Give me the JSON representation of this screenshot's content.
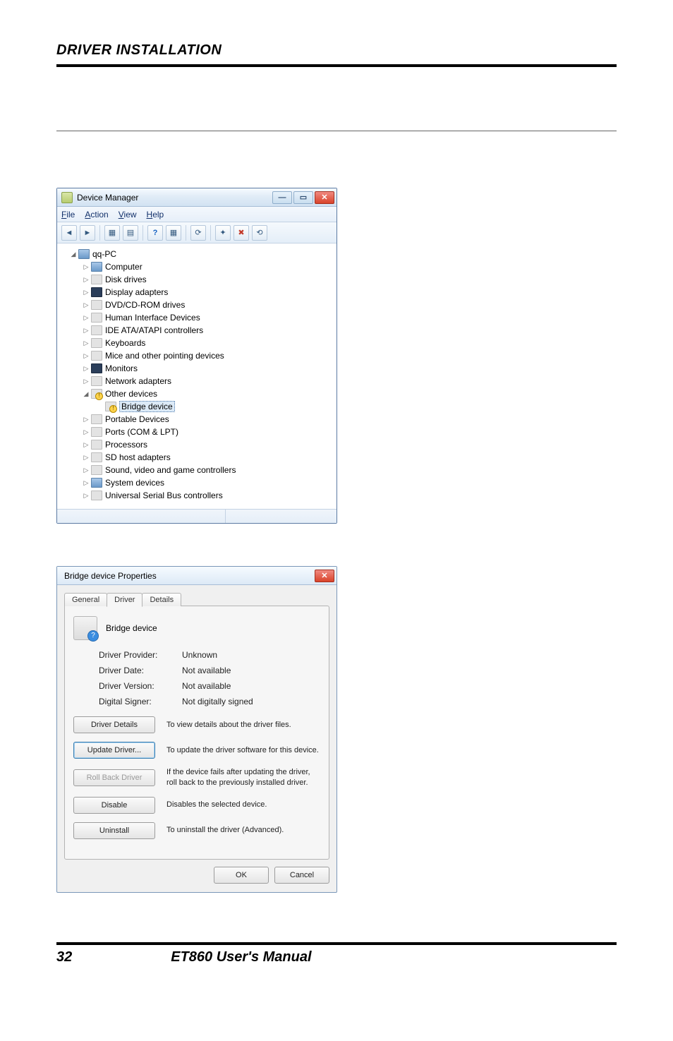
{
  "page": {
    "header": "DRIVER INSTALLATION",
    "page_number": "32",
    "footer_title": "ET860 User's Manual"
  },
  "device_manager": {
    "window_title": "Device Manager",
    "menus": {
      "file": "File",
      "action": "Action",
      "view": "View",
      "help": "Help"
    },
    "root": "qq-PC",
    "nodes": [
      "Computer",
      "Disk drives",
      "Display adapters",
      "DVD/CD-ROM drives",
      "Human Interface Devices",
      "IDE ATA/ATAPI controllers",
      "Keyboards",
      "Mice and other pointing devices",
      "Monitors",
      "Network adapters",
      "Other devices",
      "Portable Devices",
      "Ports (COM & LPT)",
      "Processors",
      "SD host adapters",
      "Sound, video and game controllers",
      "System devices",
      "Universal Serial Bus controllers"
    ],
    "selected_child": "Bridge device"
  },
  "properties": {
    "window_title": "Bridge device Properties",
    "tabs": {
      "general": "General",
      "driver": "Driver",
      "details": "Details"
    },
    "device_name": "Bridge device",
    "fields": {
      "provider_label": "Driver Provider:",
      "provider_value": "Unknown",
      "date_label": "Driver Date:",
      "date_value": "Not available",
      "version_label": "Driver Version:",
      "version_value": "Not available",
      "signer_label": "Digital Signer:",
      "signer_value": "Not digitally signed"
    },
    "actions": {
      "details_btn": "Driver Details",
      "details_desc": "To view details about the driver files.",
      "update_btn": "Update Driver...",
      "update_desc": "To update the driver software for this device.",
      "rollback_btn": "Roll Back Driver",
      "rollback_desc": "If the device fails after updating the driver, roll back to the previously installed driver.",
      "disable_btn": "Disable",
      "disable_desc": "Disables the selected device.",
      "uninstall_btn": "Uninstall",
      "uninstall_desc": "To uninstall the driver (Advanced)."
    },
    "buttons": {
      "ok": "OK",
      "cancel": "Cancel"
    }
  }
}
